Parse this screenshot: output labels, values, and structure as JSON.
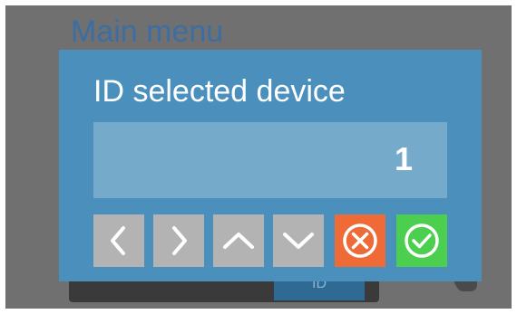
{
  "background": {
    "menu_title": "Main menu",
    "id_button_label": "ID"
  },
  "dialog": {
    "title": "ID selected device",
    "value": "1",
    "buttons": [
      {
        "name": "left-arrow",
        "icon": "chevron-left-icon"
      },
      {
        "name": "right-arrow",
        "icon": "chevron-right-icon"
      },
      {
        "name": "up-arrow",
        "icon": "chevron-up-icon"
      },
      {
        "name": "down-arrow",
        "icon": "chevron-down-icon"
      },
      {
        "name": "cancel",
        "icon": "cancel-circle-icon",
        "color": "#ee6b37"
      },
      {
        "name": "confirm",
        "icon": "check-circle-icon",
        "color": "#4ccf4e"
      }
    ]
  },
  "colors": {
    "overlay": "#707070",
    "dialog": "#4b90bd",
    "field": "#75aacb",
    "arrow_button": "#b3b3b3"
  }
}
